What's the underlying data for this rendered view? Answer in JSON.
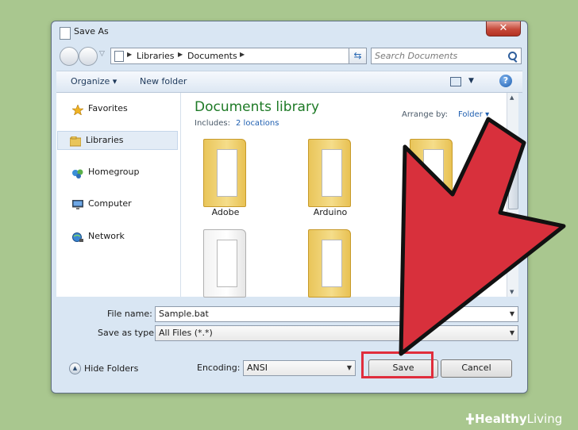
{
  "window": {
    "title": "Save As",
    "close_label": "✕"
  },
  "address": {
    "path": [
      "Libraries",
      "Documents"
    ],
    "search_placeholder": "Search Documents"
  },
  "toolbar": {
    "organize_label": "Organize ▾",
    "new_folder_label": "New folder"
  },
  "nav_pane": {
    "items": [
      {
        "label": "Favorites",
        "icon": "star-icon"
      },
      {
        "label": "Libraries",
        "icon": "libraries-icon",
        "selected": true
      },
      {
        "label": "Homegroup",
        "icon": "homegroup-icon"
      },
      {
        "label": "Computer",
        "icon": "computer-icon"
      },
      {
        "label": "Network",
        "icon": "network-icon"
      }
    ]
  },
  "library": {
    "title": "Documents library",
    "includes_label": "Includes:",
    "locations_link": "2 locations",
    "arrange_label": "Arrange by:",
    "arrange_value": "Folder ▾"
  },
  "folders": [
    {
      "name": "Adobe"
    },
    {
      "name": "Arduino"
    },
    {
      "name": ""
    },
    {
      "name": ""
    },
    {
      "name": ""
    }
  ],
  "form": {
    "file_name_label": "File name:",
    "file_name_value": "Sample.bat",
    "save_type_label": "Save as type:",
    "save_type_value": "All Files  (*.*)",
    "encoding_label": "Encoding:",
    "encoding_value": "ANSI"
  },
  "buttons": {
    "hide_folders": "Hide Folders",
    "save": "Save",
    "cancel": "Cancel"
  },
  "colors": {
    "highlight": "#e02d3c",
    "arrow": "#d8303c",
    "library_title": "#1e7a26"
  },
  "watermark": {
    "text_part1": "Healthy",
    "text_part2": "Living"
  }
}
